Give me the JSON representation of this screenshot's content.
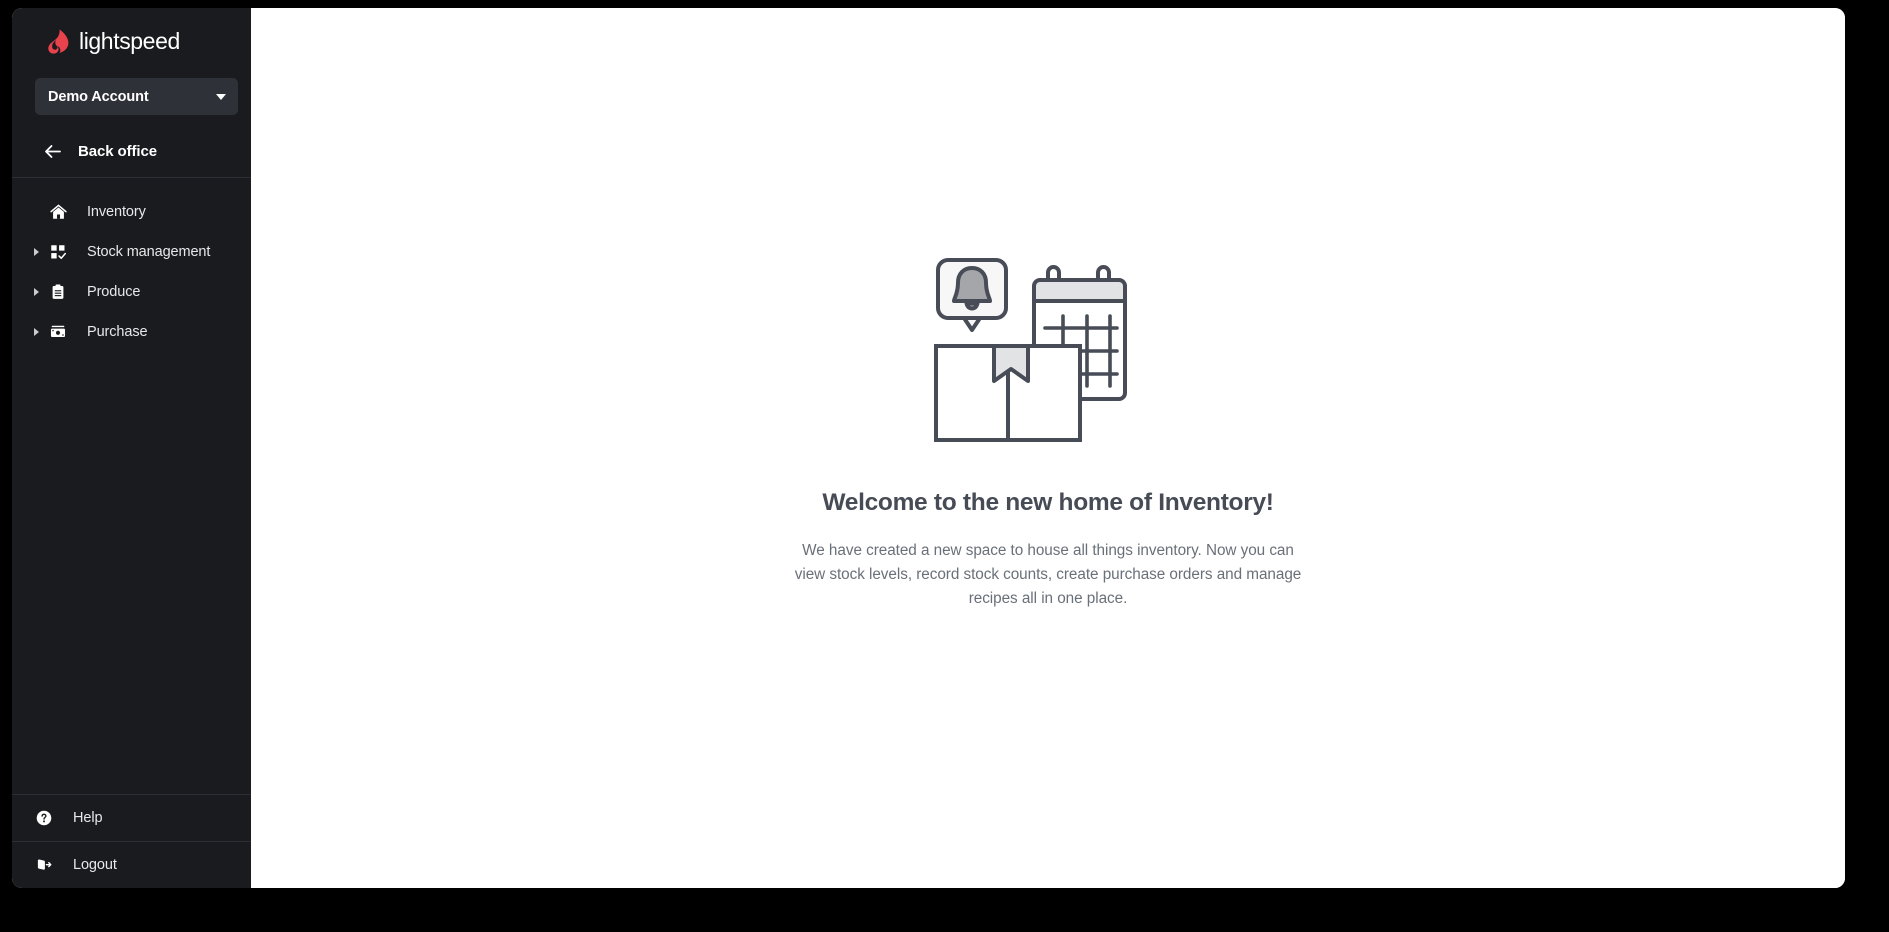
{
  "brand": {
    "name": "lightspeed",
    "logo_icon": "lightspeed-flame-icon",
    "accent_color": "#E8434C"
  },
  "sidebar": {
    "background_color": "#191B1F",
    "account": {
      "name": "Demo Account",
      "caret_icon": "chevron-down-icon"
    },
    "back_office": {
      "label": "Back office",
      "icon": "arrow-left-icon"
    },
    "items": [
      {
        "label": "Inventory",
        "icon": "home-icon",
        "expandable": false
      },
      {
        "label": "Stock management",
        "icon": "grid-check-icon",
        "expandable": true
      },
      {
        "label": "Produce",
        "icon": "clipboard-icon",
        "expandable": true
      },
      {
        "label": "Purchase",
        "icon": "banknote-icon",
        "expandable": true
      }
    ],
    "footer_items": [
      {
        "label": "Help",
        "icon": "question-circle-icon"
      },
      {
        "label": "Logout",
        "icon": "logout-icon"
      }
    ]
  },
  "main": {
    "empty_state": {
      "illustration_icon": "bell-calendar-book-illustration",
      "title": "Welcome to the new home of Inventory!",
      "body": "We have created a new space to house all things inventory. Now you can view stock levels, record stock counts, create purchase orders and manage recipes all in one place.",
      "title_color": "#464B55",
      "body_color": "#6A7079"
    }
  }
}
